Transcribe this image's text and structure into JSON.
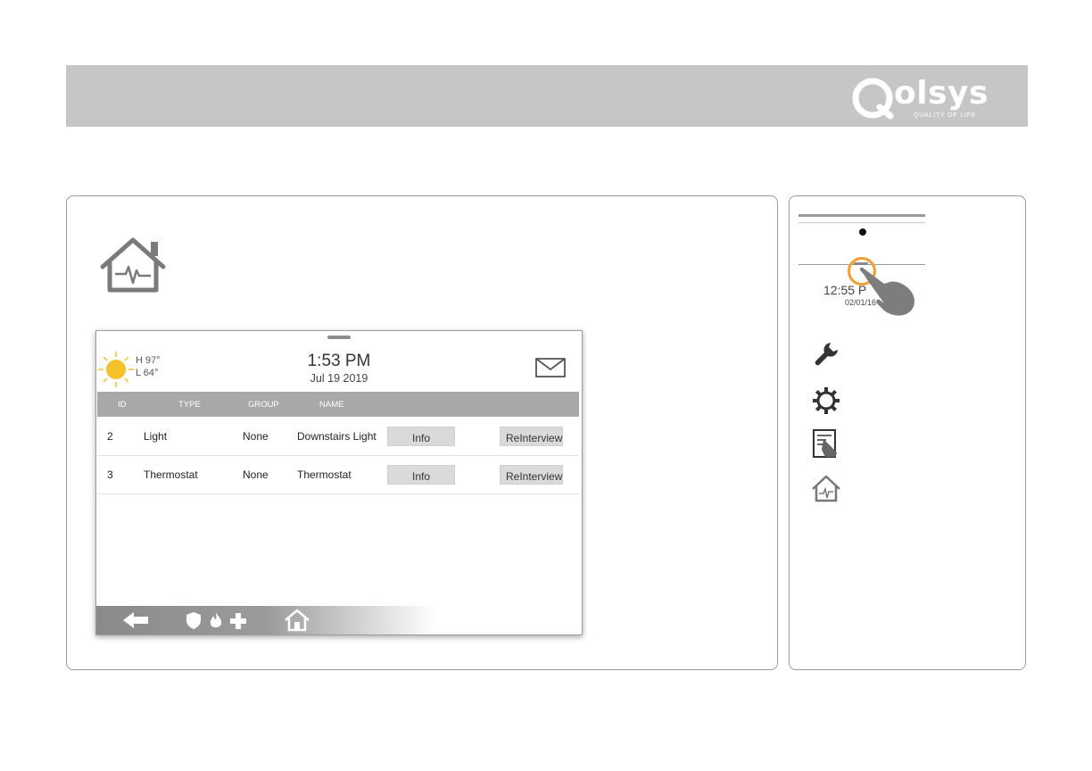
{
  "brand": {
    "logo_word": "olsys",
    "tagline": "QUALITY OF LIFE"
  },
  "device": {
    "weather": {
      "high": "H 97°",
      "low": "L 64°"
    },
    "clock": {
      "time": "1:53 PM",
      "date": "Jul 19 2019"
    },
    "table": {
      "columns": [
        "ID",
        "TYPE",
        "GROUP",
        "NAME"
      ],
      "rows": [
        {
          "id": "2",
          "type": "Light",
          "group": "None",
          "name": "Downstairs Light",
          "info_label": "Info",
          "reinterview_label": "ReInterview"
        },
        {
          "id": "3",
          "type": "Thermostat",
          "group": "None",
          "name": "Thermostat",
          "info_label": "Info",
          "reinterview_label": "ReInterview"
        }
      ]
    },
    "footer_icons": [
      "back-arrow-icon",
      "shield-icon",
      "fire-icon",
      "plus-icon",
      "home-icon"
    ]
  },
  "side_panel": {
    "mini_clock": {
      "time": "12:55 P",
      "date": "02/01/16"
    },
    "icons": [
      "wrench-icon",
      "gear-icon",
      "installation-icon",
      "smart-home-icon"
    ]
  },
  "colors": {
    "header_bar": "#c6c6c6",
    "table_header": "#a8a8a8",
    "button": "#dadada",
    "highlight_ring": "#f0a030",
    "sun": "#f7c12a"
  }
}
